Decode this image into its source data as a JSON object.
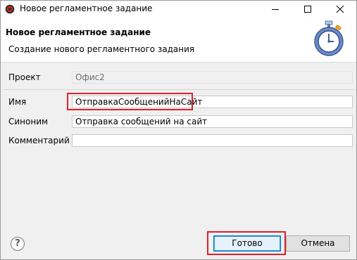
{
  "window": {
    "title": "Новое регламентное задание"
  },
  "header": {
    "title": "Новое регламентное задание",
    "subtitle": "Создание нового регламентного задания",
    "graphic_icon": "stopwatch-icon"
  },
  "form": {
    "project": {
      "label": "Проект",
      "value": "Офис2"
    },
    "name": {
      "label": "Имя",
      "value": "ОтправкаСообщенийНаСайт"
    },
    "synonym": {
      "label": "Синоним",
      "value": "Отправка сообщений на сайт"
    },
    "comment": {
      "label": "Комментарий",
      "value": ""
    }
  },
  "footer": {
    "help_icon": "help-icon",
    "help_glyph": "?",
    "finish_label": "Готово",
    "cancel_label": "Отмена"
  },
  "colors": {
    "highlight": "#e0202a",
    "primary_button_border": "#0078d7"
  }
}
